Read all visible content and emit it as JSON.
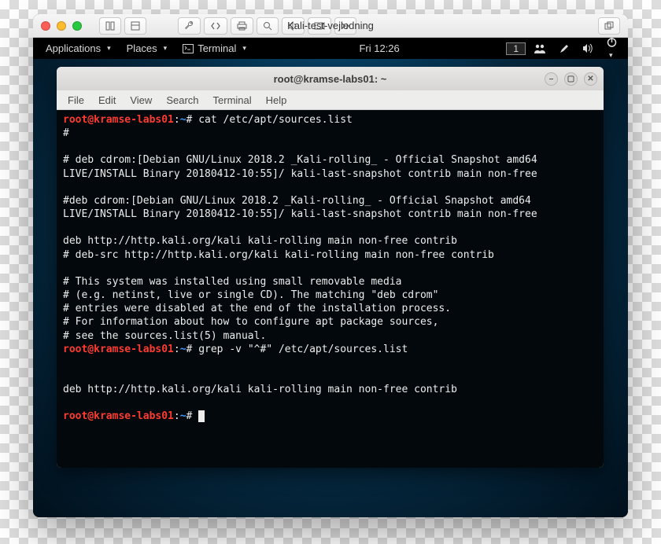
{
  "mac": {
    "title": "Kali-test-vejledning",
    "toolbar_icons": [
      "panes-icon",
      "layout-icon",
      "wrench-icon",
      "code-icon",
      "printer-icon",
      "search-zoom-icon",
      "volume-icon",
      "camera-icon",
      "overflow-icon",
      "window-overlap-icon"
    ]
  },
  "gnome": {
    "applications": "Applications",
    "places": "Places",
    "terminal": "Terminal",
    "clock": "Fri 12:26",
    "workspace": "1"
  },
  "terminal": {
    "title": "root@kramse-labs01: ~",
    "menu": [
      "File",
      "Edit",
      "View",
      "Search",
      "Terminal",
      "Help"
    ],
    "prompt_user": "root@kramse-labs01",
    "prompt_sep": ":",
    "prompt_path": "~",
    "prompt_hash": "#",
    "cmd1": "cat /etc/apt/sources.list",
    "out1a": "#",
    "out1b": "# deb cdrom:[Debian GNU/Linux 2018.2 _Kali-rolling_ - Official Snapshot amd64 LIVE/INSTALL Binary 20180412-10:55]/ kali-last-snapshot contrib main non-free",
    "out1c": "#deb cdrom:[Debian GNU/Linux 2018.2 _Kali-rolling_ - Official Snapshot amd64 LIVE/INSTALL Binary 20180412-10:55]/ kali-last-snapshot contrib main non-free",
    "out1d": "deb http://http.kali.org/kali kali-rolling main non-free contrib",
    "out1e": "# deb-src http://http.kali.org/kali kali-rolling main non-free contrib",
    "out1f": "# This system was installed using small removable media",
    "out1g": "# (e.g. netinst, live or single CD). The matching \"deb cdrom\"",
    "out1h": "# entries were disabled at the end of the installation process.",
    "out1i": "# For information about how to configure apt package sources,",
    "out1j": "# see the sources.list(5) manual.",
    "cmd2": "grep -v \"^#\" /etc/apt/sources.list",
    "out2a": "deb http://http.kali.org/kali kali-rolling main non-free contrib"
  }
}
